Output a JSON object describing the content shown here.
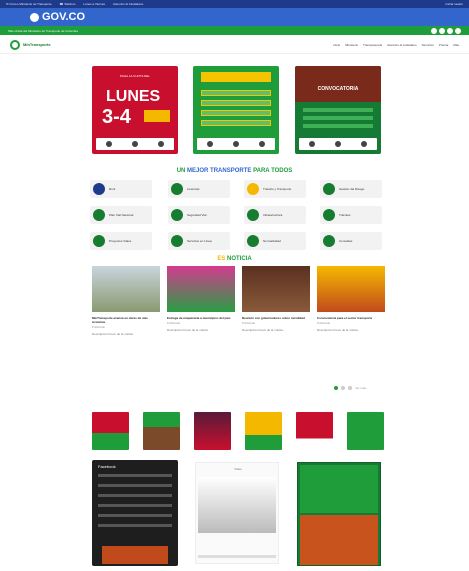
{
  "topbar": {
    "items": [
      "✉ Correo Ministerio de Transporte",
      "☎ Teléfono",
      "Lunes a Viernes",
      "Atención al Ciudadano"
    ],
    "right": "Iniciar sesión"
  },
  "gov": {
    "logo_text": "GOV.CO"
  },
  "greenbar": {
    "text": "Sitio oficial del Ministerio de Transporte de Colombia"
  },
  "nav": {
    "brand": "MinTransporte",
    "items": [
      "Inicio",
      "Ministerio",
      "Transparencia",
      "Atención al ciudadano",
      "Servicios",
      "Prensa",
      "Más"
    ]
  },
  "posters": [
    {
      "heading": "PAGA LA CUOTA DEL",
      "big1": "LUNES",
      "big2": "3-4"
    },
    {
      "heading": ""
    },
    {
      "heading": "CONVOCATORIA"
    }
  ],
  "tiles_title": {
    "a": "UN ",
    "b": "MEJOR TRANSPORTE ",
    "c": "PARA TODOS"
  },
  "tiles": [
    {
      "label": "Runt"
    },
    {
      "label": "Licencias"
    },
    {
      "label": "Transito y Transporte"
    },
    {
      "label": "Gestión del Riesgo"
    },
    {
      "label": "Plan Vial Nacional"
    },
    {
      "label": "Seguridad Vial"
    },
    {
      "label": "Infraestructura"
    },
    {
      "label": "Trámites"
    },
    {
      "label": "Proyectos Viales"
    },
    {
      "label": "Servicios en Línea"
    },
    {
      "label": "Normatividad"
    },
    {
      "label": "Consultas"
    }
  ],
  "news_title": {
    "a": "ES ",
    "b": "NOTICIA"
  },
  "news": [
    {
      "title": "MinTransporte avanza en obras de vías terciarias",
      "date": "Publicado",
      "body": "Descripción breve de la noticia."
    },
    {
      "title": "Entrega de maquinaria a municipios del país",
      "date": "Publicado",
      "body": "Descripción breve de la noticia."
    },
    {
      "title": "Reunión con gobernadores sobre movilidad",
      "date": "Publicado",
      "body": "Descripción breve de la noticia."
    },
    {
      "title": "Convocatoria para el sector transporte",
      "date": "Publicado",
      "body": "Descripción breve de la noticia."
    }
  ],
  "pager": "Ver más",
  "social": {
    "fb_title": "Facebook",
    "video_title": "Video"
  }
}
